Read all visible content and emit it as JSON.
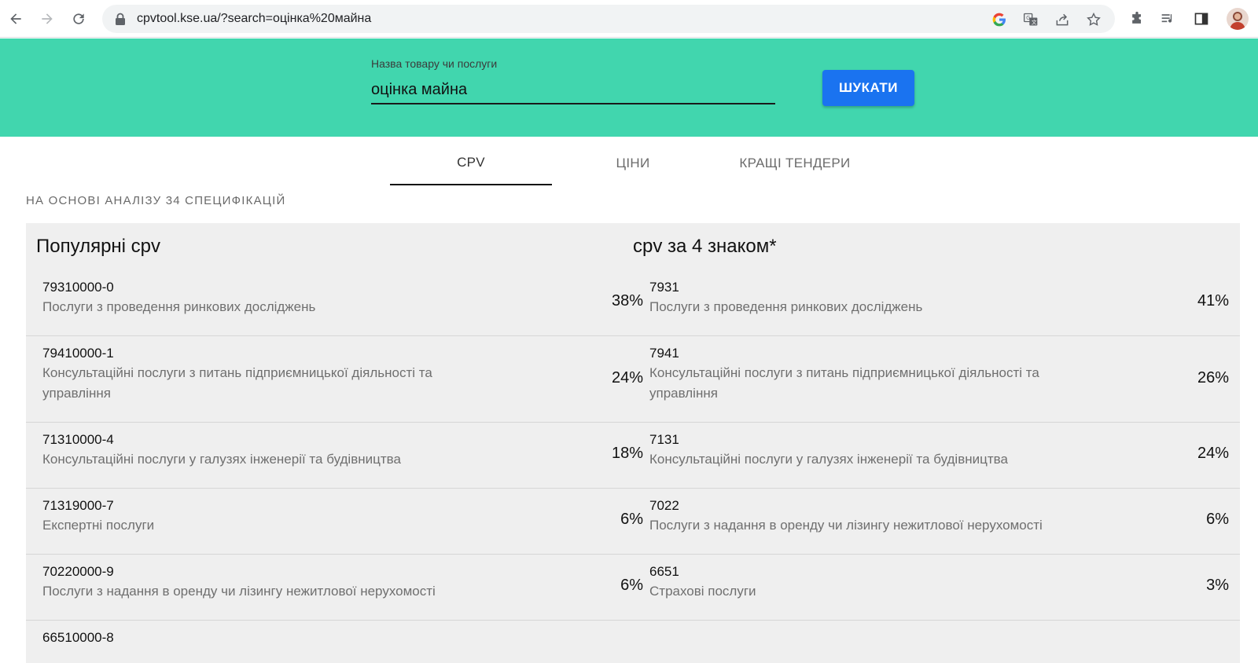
{
  "browser": {
    "url": "cpvtool.kse.ua/?search=оцінка%20майна"
  },
  "search": {
    "label": "Назва товару чи послуги",
    "value": "оцінка майна",
    "button_label": "ШУКАТИ"
  },
  "tabs": [
    {
      "label": "CPV",
      "active": true
    },
    {
      "label": "ЦІНИ",
      "active": false
    },
    {
      "label": "КРАЩІ ТЕНДЕРИ",
      "active": false
    }
  ],
  "analysis_note": "НА ОСНОВІ АНАЛІЗУ 34 СПЕЦИФІКАЦІЙ",
  "popular": {
    "title": "Популярні cpv",
    "rows": [
      {
        "code": "79310000-0",
        "desc": "Послуги з проведення ринкових досліджень",
        "pct": "38%"
      },
      {
        "code": "79410000-1",
        "desc": "Консультаційні послуги з питань підприємницької діяльності та управління",
        "pct": "24%"
      },
      {
        "code": "71310000-4",
        "desc": "Консультаційні послуги у галузях інженерії та будівництва",
        "pct": "18%"
      },
      {
        "code": "71319000-7",
        "desc": "Експертні послуги",
        "pct": "6%"
      },
      {
        "code": "70220000-9",
        "desc": "Послуги з надання в оренду чи лізингу нежитлової нерухомості",
        "pct": "6%"
      },
      {
        "code": "66510000-8",
        "desc": "",
        "pct": ""
      }
    ]
  },
  "four_digit": {
    "title": "cpv за 4 знаком*",
    "rows": [
      {
        "code": "7931",
        "desc": "Послуги з проведення ринкових досліджень",
        "pct": "41%"
      },
      {
        "code": "7941",
        "desc": "Консультаційні послуги з питань підприємницької діяльності та управління",
        "pct": "26%"
      },
      {
        "code": "7131",
        "desc": "Консультаційні послуги у галузях інженерії та будівництва",
        "pct": "24%"
      },
      {
        "code": "7022",
        "desc": "Послуги з надання в оренду чи лізингу нежитлової нерухомості",
        "pct": "6%"
      },
      {
        "code": "6651",
        "desc": "Страхові послуги",
        "pct": "3%"
      }
    ]
  },
  "colors": {
    "header_band": "#41d6ae",
    "button": "#1a73f0",
    "panel": "#efefef"
  }
}
